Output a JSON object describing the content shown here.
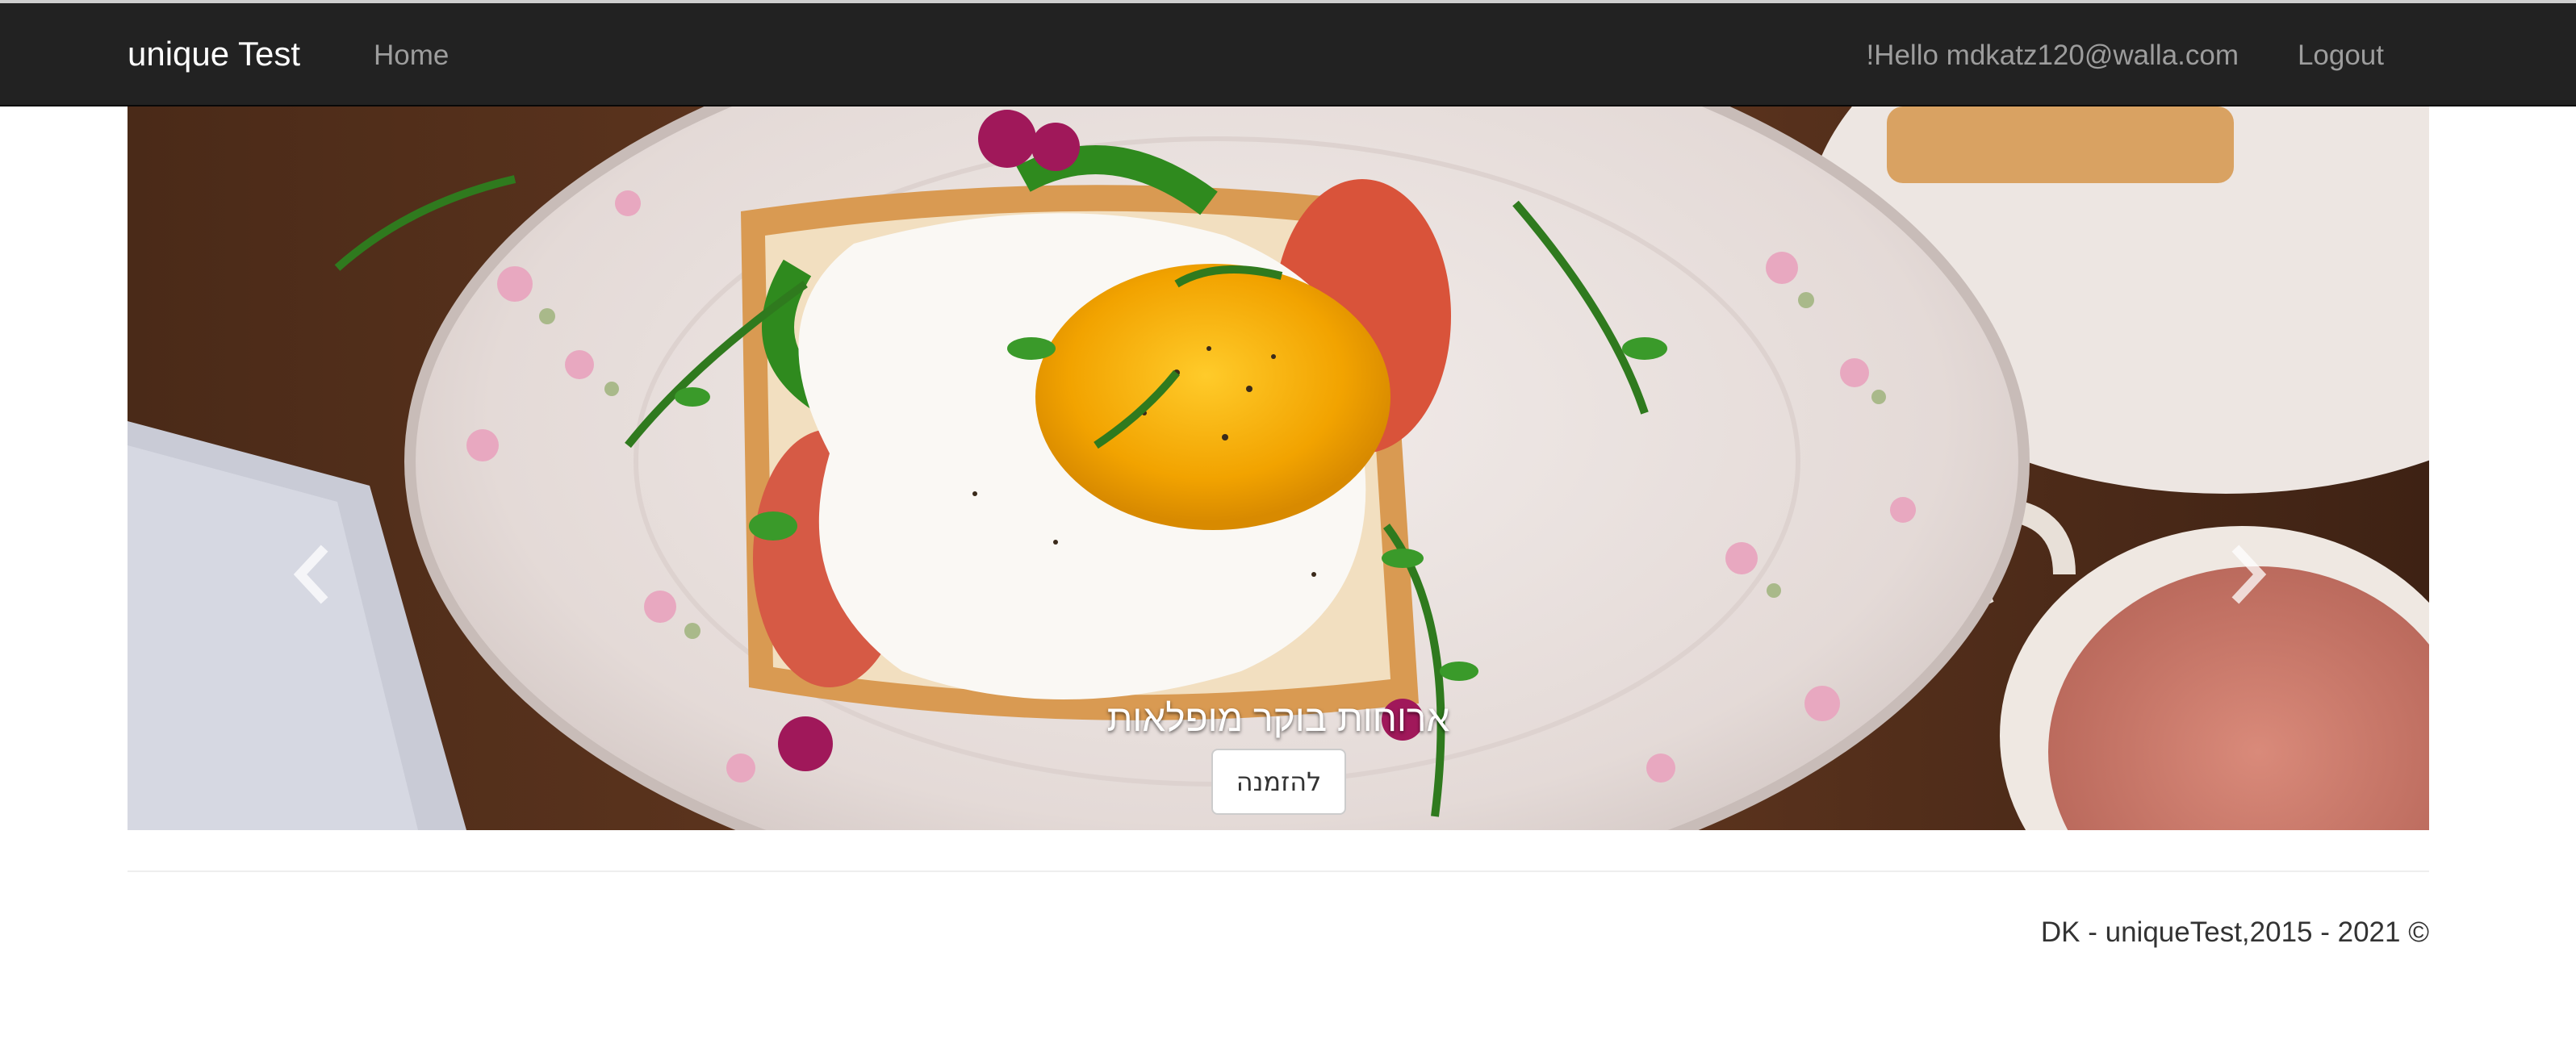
{
  "navbar": {
    "brand": "unique Test",
    "home_label": "Home",
    "greeting": "!Hello mdkatz120@walla.com",
    "logout_label": "Logout"
  },
  "carousel": {
    "caption": "ארוחות בוקר מופלאות",
    "order_button_label": "להזמנה",
    "indicator_count": 3,
    "active_indicator": 3
  },
  "footer": {
    "text": "DK - uniqueTest,2015 - 2021 ©"
  },
  "colors": {
    "navbar_bg": "#222222",
    "nav_link": "#9d9d9d",
    "brand": "#ffffff"
  }
}
